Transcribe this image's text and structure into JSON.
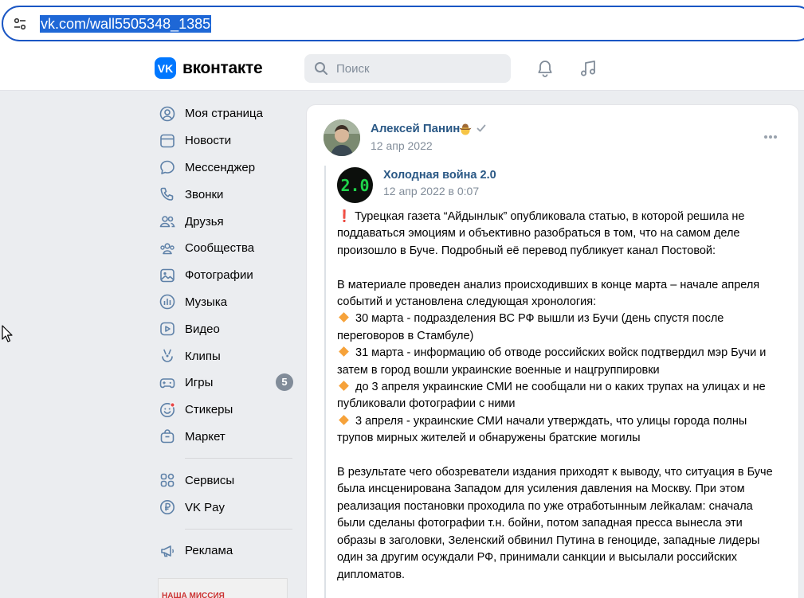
{
  "browser": {
    "url": "vk.com/wall5505348_1385"
  },
  "header": {
    "logo_text": "VK",
    "brand": "вконтакте",
    "search_placeholder": "Поиск"
  },
  "colors": {
    "vk_blue": "#0077ff",
    "link_blue": "#2a5885",
    "muted": "#818c99",
    "background": "#ebedf0"
  },
  "nav": {
    "items": [
      {
        "label": "Моя страница",
        "icon": "user-circle-icon"
      },
      {
        "label": "Новости",
        "icon": "news-icon"
      },
      {
        "label": "Мессенджер",
        "icon": "message-icon"
      },
      {
        "label": "Звонки",
        "icon": "phone-icon"
      },
      {
        "label": "Друзья",
        "icon": "friends-icon"
      },
      {
        "label": "Сообщества",
        "icon": "communities-icon"
      },
      {
        "label": "Фотографии",
        "icon": "photo-icon"
      },
      {
        "label": "Музыка",
        "icon": "music-icon"
      },
      {
        "label": "Видео",
        "icon": "video-icon"
      },
      {
        "label": "Клипы",
        "icon": "clips-icon"
      },
      {
        "label": "Игры",
        "icon": "gamepad-icon",
        "badge": "5"
      },
      {
        "label": "Стикеры",
        "icon": "sticker-icon"
      },
      {
        "label": "Маркет",
        "icon": "market-icon"
      }
    ],
    "secondary": [
      {
        "label": "Сервисы",
        "icon": "services-icon"
      },
      {
        "label": "VK Pay",
        "icon": "vkpay-icon"
      }
    ],
    "tertiary": [
      {
        "label": "Реклама",
        "icon": "megaphone-icon"
      }
    ],
    "promo_text": "НАША МИССИЯ"
  },
  "post": {
    "author": "Алексей Панин",
    "date": "12 апр 2022",
    "repost": {
      "author": "Холодная война 2.0",
      "avatar_text": "2.0",
      "date": "12 апр 2022 в 0:07"
    },
    "intro": "Турецкая газета “Айдынлык” опубликовала статью, в которой решила не поддаваться эмоциям и объективно разобраться в том, что на самом деле произошло в Буче. Подробный её перевод публикует канал Постовой:",
    "chronology_intro": "В материале проведен анализ происходивших в конце марта – начале апреля событий и установлена следующая хронология:",
    "events": [
      "30 марта - подразделения ВС РФ вышли из Бучи (день спустя после переговоров в Стамбуле)",
      "31 марта - информацию об отводе российских войск подтвердил мэр Бучи и затем в город вошли украинские военные и нацгруппировки",
      "до 3 апреля украинские СМИ не сообщали ни о каких трупах на улицах и не публиковали фотографии с ними",
      "3 апреля - украинские СМИ начали утверждать, что улицы города полны трупов мирных жителей и обнаружены братские могилы"
    ],
    "conclusion": "В результате чего обозреватели издания приходят к выводу, что ситуация в Буче была инсценирована Западом для усиления давления на Москву. При этом реализация постановки проходила по уже отработынным лейкалам: сначала были сделаны фотографии т.н. бойни, потом западная пресса вынесла эти образы в заголовки, Зеленский обвинил Путина в геноциде, западные лидеры один за другим осуждали РФ, принимали санкции и высылали российских дипломатов."
  }
}
